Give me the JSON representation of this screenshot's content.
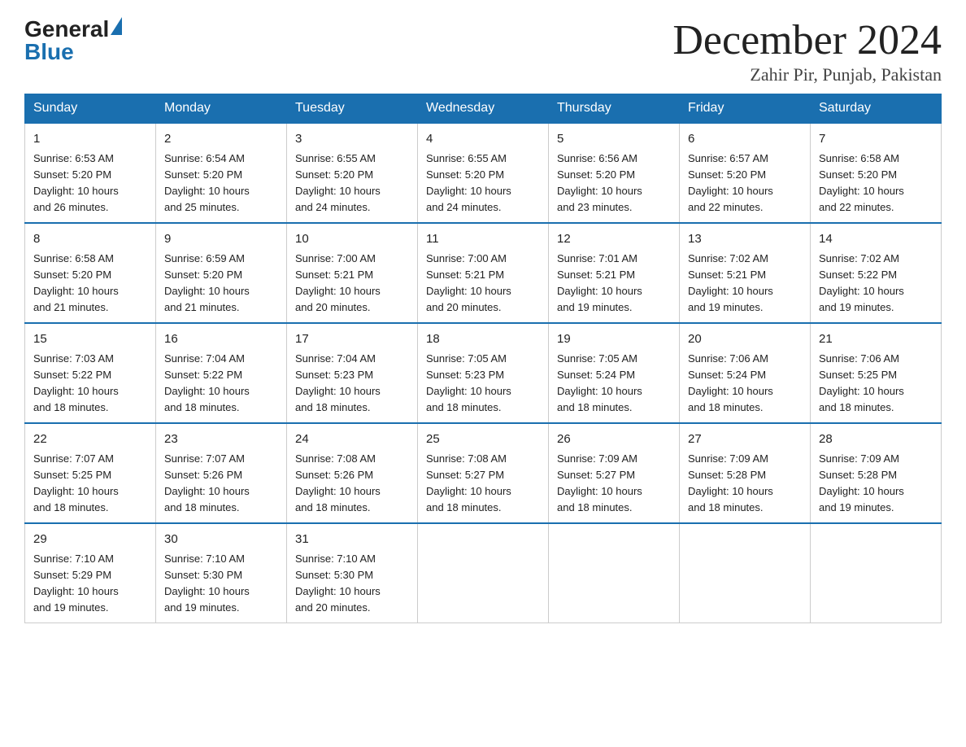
{
  "logo": {
    "text_general": "General",
    "text_blue": "Blue"
  },
  "title": {
    "month": "December 2024",
    "location": "Zahir Pir, Punjab, Pakistan"
  },
  "header_days": [
    "Sunday",
    "Monday",
    "Tuesday",
    "Wednesday",
    "Thursday",
    "Friday",
    "Saturday"
  ],
  "weeks": [
    [
      {
        "day": "1",
        "sunrise": "6:53 AM",
        "sunset": "5:20 PM",
        "daylight": "10 hours and 26 minutes."
      },
      {
        "day": "2",
        "sunrise": "6:54 AM",
        "sunset": "5:20 PM",
        "daylight": "10 hours and 25 minutes."
      },
      {
        "day": "3",
        "sunrise": "6:55 AM",
        "sunset": "5:20 PM",
        "daylight": "10 hours and 24 minutes."
      },
      {
        "day": "4",
        "sunrise": "6:55 AM",
        "sunset": "5:20 PM",
        "daylight": "10 hours and 24 minutes."
      },
      {
        "day": "5",
        "sunrise": "6:56 AM",
        "sunset": "5:20 PM",
        "daylight": "10 hours and 23 minutes."
      },
      {
        "day": "6",
        "sunrise": "6:57 AM",
        "sunset": "5:20 PM",
        "daylight": "10 hours and 22 minutes."
      },
      {
        "day": "7",
        "sunrise": "6:58 AM",
        "sunset": "5:20 PM",
        "daylight": "10 hours and 22 minutes."
      }
    ],
    [
      {
        "day": "8",
        "sunrise": "6:58 AM",
        "sunset": "5:20 PM",
        "daylight": "10 hours and 21 minutes."
      },
      {
        "day": "9",
        "sunrise": "6:59 AM",
        "sunset": "5:20 PM",
        "daylight": "10 hours and 21 minutes."
      },
      {
        "day": "10",
        "sunrise": "7:00 AM",
        "sunset": "5:21 PM",
        "daylight": "10 hours and 20 minutes."
      },
      {
        "day": "11",
        "sunrise": "7:00 AM",
        "sunset": "5:21 PM",
        "daylight": "10 hours and 20 minutes."
      },
      {
        "day": "12",
        "sunrise": "7:01 AM",
        "sunset": "5:21 PM",
        "daylight": "10 hours and 19 minutes."
      },
      {
        "day": "13",
        "sunrise": "7:02 AM",
        "sunset": "5:21 PM",
        "daylight": "10 hours and 19 minutes."
      },
      {
        "day": "14",
        "sunrise": "7:02 AM",
        "sunset": "5:22 PM",
        "daylight": "10 hours and 19 minutes."
      }
    ],
    [
      {
        "day": "15",
        "sunrise": "7:03 AM",
        "sunset": "5:22 PM",
        "daylight": "10 hours and 18 minutes."
      },
      {
        "day": "16",
        "sunrise": "7:04 AM",
        "sunset": "5:22 PM",
        "daylight": "10 hours and 18 minutes."
      },
      {
        "day": "17",
        "sunrise": "7:04 AM",
        "sunset": "5:23 PM",
        "daylight": "10 hours and 18 minutes."
      },
      {
        "day": "18",
        "sunrise": "7:05 AM",
        "sunset": "5:23 PM",
        "daylight": "10 hours and 18 minutes."
      },
      {
        "day": "19",
        "sunrise": "7:05 AM",
        "sunset": "5:24 PM",
        "daylight": "10 hours and 18 minutes."
      },
      {
        "day": "20",
        "sunrise": "7:06 AM",
        "sunset": "5:24 PM",
        "daylight": "10 hours and 18 minutes."
      },
      {
        "day": "21",
        "sunrise": "7:06 AM",
        "sunset": "5:25 PM",
        "daylight": "10 hours and 18 minutes."
      }
    ],
    [
      {
        "day": "22",
        "sunrise": "7:07 AM",
        "sunset": "5:25 PM",
        "daylight": "10 hours and 18 minutes."
      },
      {
        "day": "23",
        "sunrise": "7:07 AM",
        "sunset": "5:26 PM",
        "daylight": "10 hours and 18 minutes."
      },
      {
        "day": "24",
        "sunrise": "7:08 AM",
        "sunset": "5:26 PM",
        "daylight": "10 hours and 18 minutes."
      },
      {
        "day": "25",
        "sunrise": "7:08 AM",
        "sunset": "5:27 PM",
        "daylight": "10 hours and 18 minutes."
      },
      {
        "day": "26",
        "sunrise": "7:09 AM",
        "sunset": "5:27 PM",
        "daylight": "10 hours and 18 minutes."
      },
      {
        "day": "27",
        "sunrise": "7:09 AM",
        "sunset": "5:28 PM",
        "daylight": "10 hours and 18 minutes."
      },
      {
        "day": "28",
        "sunrise": "7:09 AM",
        "sunset": "5:28 PM",
        "daylight": "10 hours and 19 minutes."
      }
    ],
    [
      {
        "day": "29",
        "sunrise": "7:10 AM",
        "sunset": "5:29 PM",
        "daylight": "10 hours and 19 minutes."
      },
      {
        "day": "30",
        "sunrise": "7:10 AM",
        "sunset": "5:30 PM",
        "daylight": "10 hours and 19 minutes."
      },
      {
        "day": "31",
        "sunrise": "7:10 AM",
        "sunset": "5:30 PM",
        "daylight": "10 hours and 20 minutes."
      },
      null,
      null,
      null,
      null
    ]
  ],
  "labels": {
    "sunrise": "Sunrise:",
    "sunset": "Sunset:",
    "daylight": "Daylight:"
  }
}
